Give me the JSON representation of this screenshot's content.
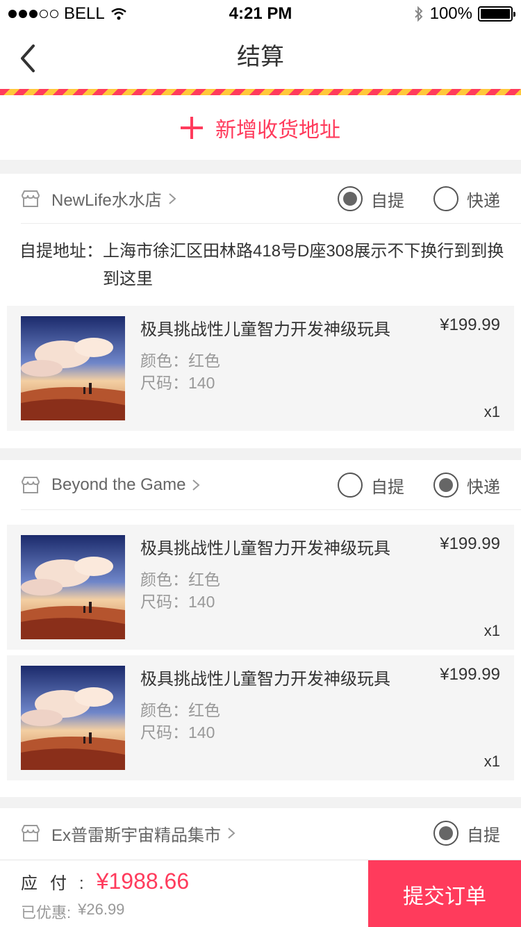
{
  "status": {
    "carrier": "BELL",
    "time": "4:21 PM",
    "battery": "100%",
    "battery_level": 1.0
  },
  "nav": {
    "title": "结算"
  },
  "address": {
    "add_label": "新增收货地址"
  },
  "options": {
    "pickup": "自提",
    "express": "快递"
  },
  "shops": [
    {
      "name": "NewLife水水店",
      "selected": "pickup",
      "pickup_address_label": "自提地址：",
      "pickup_address": "上海市徐汇区田林路418号D座308展示不下换行到到换到这里",
      "items": [
        {
          "title": "极具挑战性儿童智力开发神级玩具",
          "price": "¥199.99",
          "color": "颜色：红色",
          "size": "尺码：140",
          "qty": "x1"
        }
      ]
    },
    {
      "name": "Beyond the Game",
      "selected": "express",
      "items": [
        {
          "title": "极具挑战性儿童智力开发神级玩具",
          "price": "¥199.99",
          "color": "颜色：红色",
          "size": "尺码：140",
          "qty": "x1"
        },
        {
          "title": "极具挑战性儿童智力开发神级玩具",
          "price": "¥199.99",
          "color": "颜色：红色",
          "size": "尺码：140",
          "qty": "x1"
        }
      ]
    },
    {
      "name": "Ex普雷斯宇宙精品集市",
      "selected": "pickup",
      "items": []
    }
  ],
  "footer": {
    "pay_label": "应付:",
    "pay_amount": "¥1988.66",
    "discount_label": "已优惠:",
    "discount_amount": "¥26.99",
    "submit_label": "提交订单"
  },
  "colors": {
    "accent": "#ff3b5c",
    "stripe_alt": "#ffc83a"
  }
}
